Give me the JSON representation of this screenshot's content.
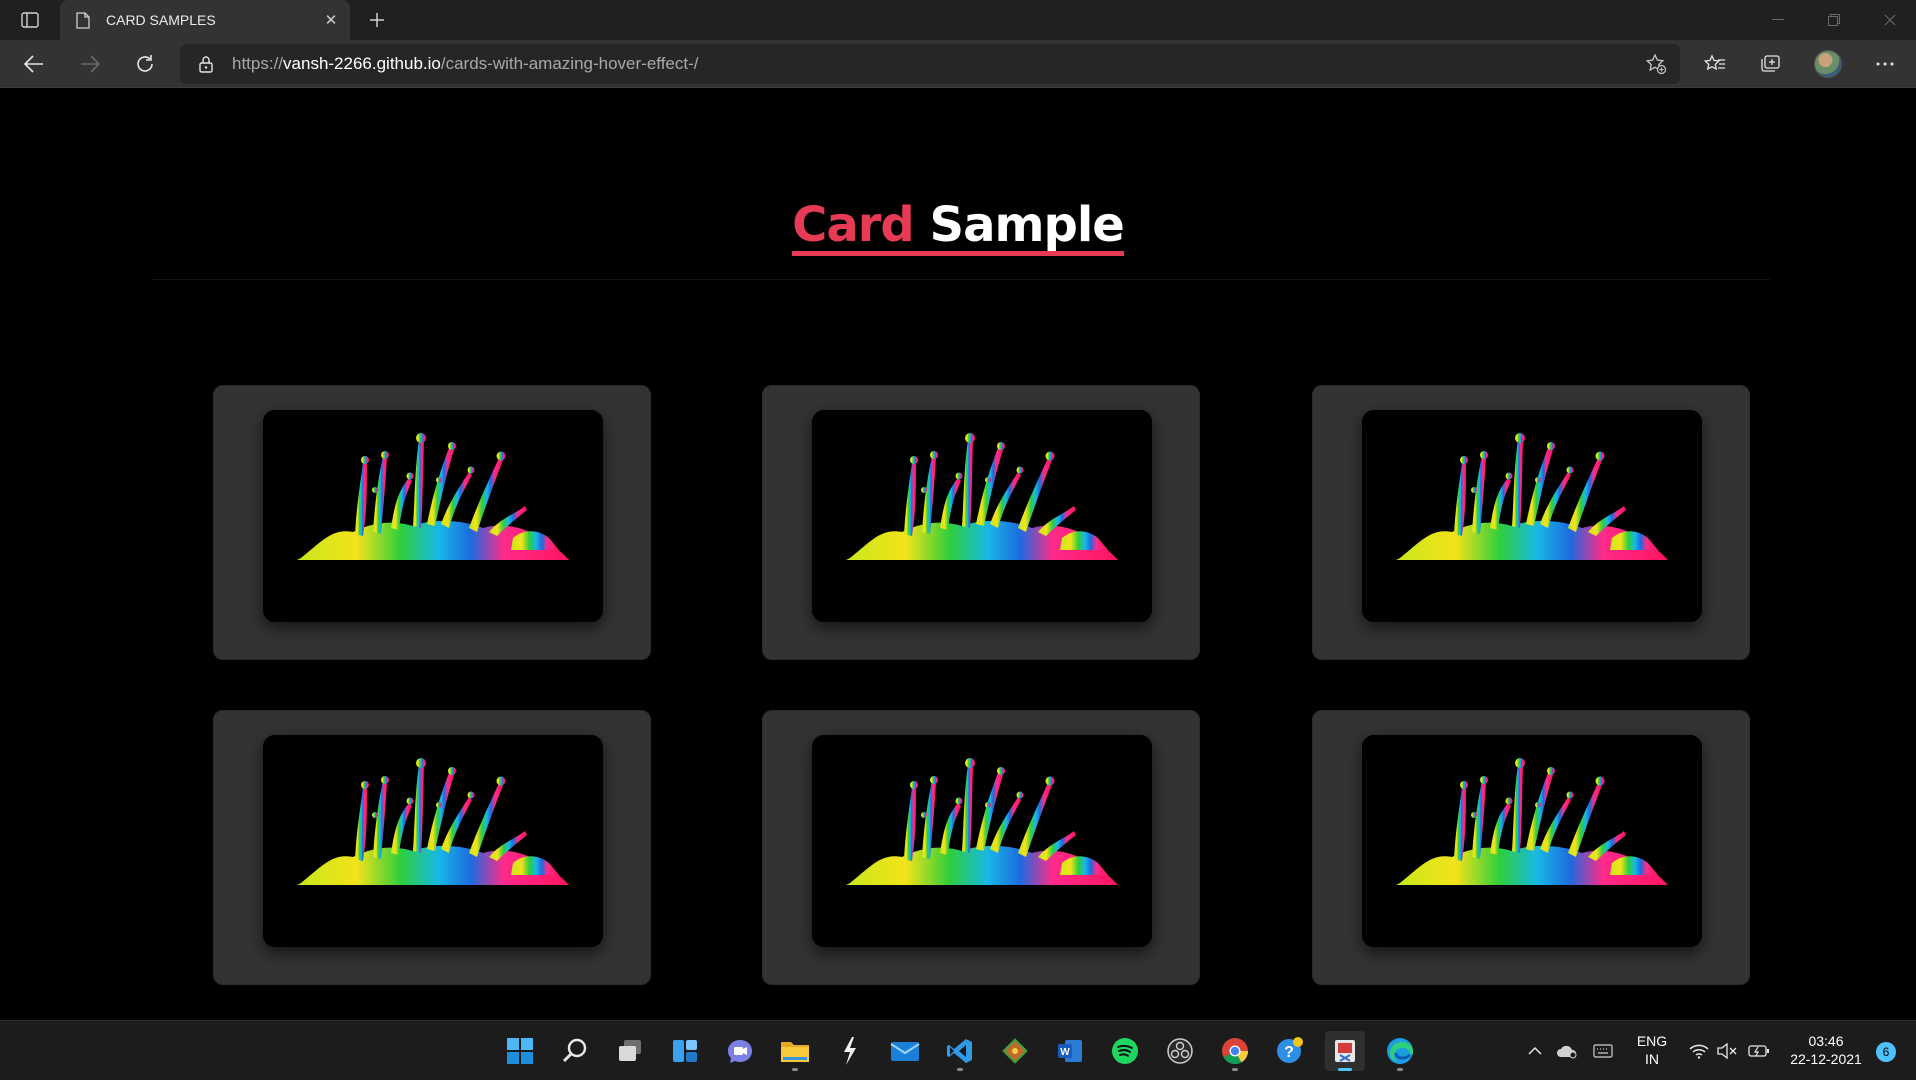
{
  "browser": {
    "tab_title": "CARD SAMPLES",
    "url_scheme": "https://",
    "url_host": "vansh-2266.github.io",
    "url_path": "/cards-with-amazing-hover-effect-/"
  },
  "page": {
    "heading_word1": "Card",
    "heading_word2": "Sample",
    "accent_color": "#e63a55",
    "card_color": "#333333",
    "cards": [
      {
        "image": "paint-splash-image"
      },
      {
        "image": "paint-splash-image"
      },
      {
        "image": "paint-splash-image"
      },
      {
        "image": "paint-splash-image"
      },
      {
        "image": "paint-splash-image"
      },
      {
        "image": "paint-splash-image"
      }
    ]
  },
  "taskbar": {
    "apps": [
      "start",
      "search",
      "task-view",
      "widgets",
      "teams-chat",
      "file-explorer",
      "app",
      "mail",
      "vs-code",
      "git",
      "word",
      "spotify",
      "obs",
      "chrome",
      "help",
      "snipping-tool",
      "edge"
    ],
    "lang_line1": "ENG",
    "lang_line2": "IN",
    "time": "03:46",
    "date": "22-12-2021",
    "notification_count": "6"
  }
}
